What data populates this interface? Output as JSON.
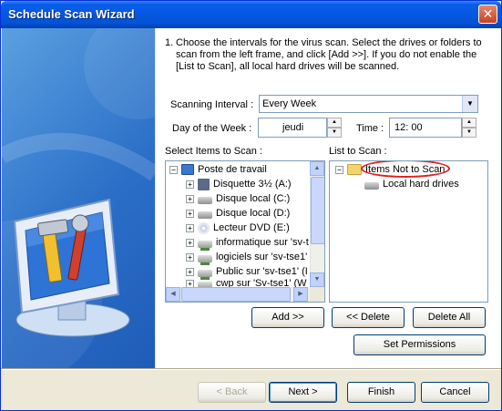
{
  "window": {
    "title": "Schedule Scan Wizard"
  },
  "instructions": {
    "number": "1.",
    "text": "Choose the intervals for the virus scan. Select the drives or folders to scan from the left frame, and click [Add >>]. If you do not enable the [List to Scan], all local hard drives will be scanned."
  },
  "schedule": {
    "interval_label": "Scanning Interval :",
    "interval_value": "Every Week",
    "day_label": "Day of the Week :",
    "day_value": "jeudi",
    "time_label": "Time :",
    "time_value": "12: 00"
  },
  "select_items": {
    "label": "Select Items to Scan :",
    "root": "Poste de travail",
    "items": [
      {
        "label": "Disquette 3½ (A:)",
        "icon": "floppy-icon"
      },
      {
        "label": "Disque local (C:)",
        "icon": "hard-drive-icon"
      },
      {
        "label": "Disque local (D:)",
        "icon": "hard-drive-icon"
      },
      {
        "label": "Lecteur DVD (E:)",
        "icon": "dvd-drive-icon"
      },
      {
        "label": "informatique sur 'sv-t",
        "icon": "network-drive-icon"
      },
      {
        "label": "logiciels sur 'sv-tse1'",
        "icon": "network-drive-icon"
      },
      {
        "label": "Public sur 'sv-tse1' (I",
        "icon": "network-drive-icon"
      },
      {
        "label": "cwp sur 'Sv-tse1' (W",
        "icon": "network-drive-icon"
      }
    ]
  },
  "list_to_scan": {
    "label": "List to Scan :",
    "root": "Items Not to Scan",
    "child": "Local hard drives"
  },
  "buttons": {
    "add": "Add >>",
    "delete": "<< Delete",
    "delete_all": "Delete All",
    "set_permissions": "Set Permissions",
    "back": "< Back",
    "next": "Next >",
    "finish": "Finish",
    "cancel": "Cancel"
  },
  "colors": {
    "titlebar": "#0558e0",
    "highlight": "#e02020",
    "panel_background": "#ece9d8"
  }
}
